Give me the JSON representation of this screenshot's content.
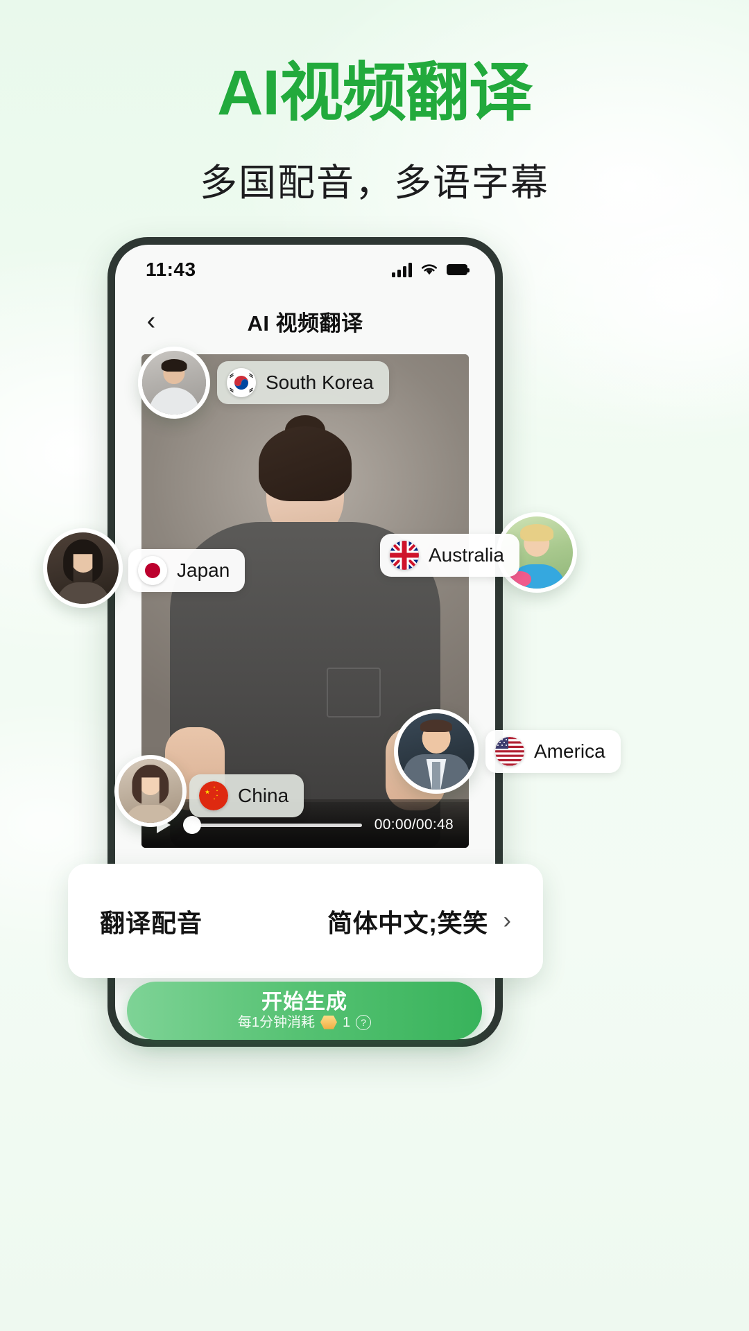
{
  "poster": {
    "title": "AI视频翻译",
    "subtitle": "多国配音，多语字幕",
    "accent_color": "#22aa3c",
    "background_color": "#eefaf0"
  },
  "phone": {
    "status_bar": {
      "time": "11:43",
      "signal_icon": "cellular-signal-icon",
      "wifi_icon": "wifi-icon",
      "battery_icon": "battery-full-icon"
    },
    "nav": {
      "back_icon": "chevron-left-icon",
      "title": "AI 视频翻译"
    },
    "player": {
      "play_icon": "play-icon",
      "current_time": "00:00",
      "total_time": "00:48",
      "time_label": "00:00/00:48",
      "progress_percent": 0
    },
    "chips": [
      {
        "label": "South Korea",
        "flag_icon": "flag-south-korea-icon",
        "style": "grey"
      },
      {
        "label": "Japan",
        "flag_icon": "flag-japan-icon",
        "style": "light"
      },
      {
        "label": "Australia",
        "flag_icon": "flag-australia-icon",
        "style": "light"
      },
      {
        "label": "America",
        "flag_icon": "flag-usa-icon",
        "style": "light"
      },
      {
        "label": "China",
        "flag_icon": "flag-china-icon",
        "style": "grey"
      }
    ],
    "avatars": [
      {
        "name": "avatar-korean-man"
      },
      {
        "name": "avatar-japanese-woman"
      },
      {
        "name": "avatar-australian-child"
      },
      {
        "name": "avatar-american-man"
      },
      {
        "name": "avatar-chinese-woman"
      }
    ],
    "settings_row": {
      "label": "翻译配音",
      "value": "简体中文;笑笑",
      "chevron_icon": "chevron-right-icon"
    },
    "cta": {
      "title": "开始生成",
      "sub_prefix": "每1分钟消耗",
      "gem_icon": "gem-icon",
      "cost": "1",
      "help_icon": "question-mark-icon",
      "gradient_start": "#7ed396",
      "gradient_end": "#38b35b"
    }
  }
}
